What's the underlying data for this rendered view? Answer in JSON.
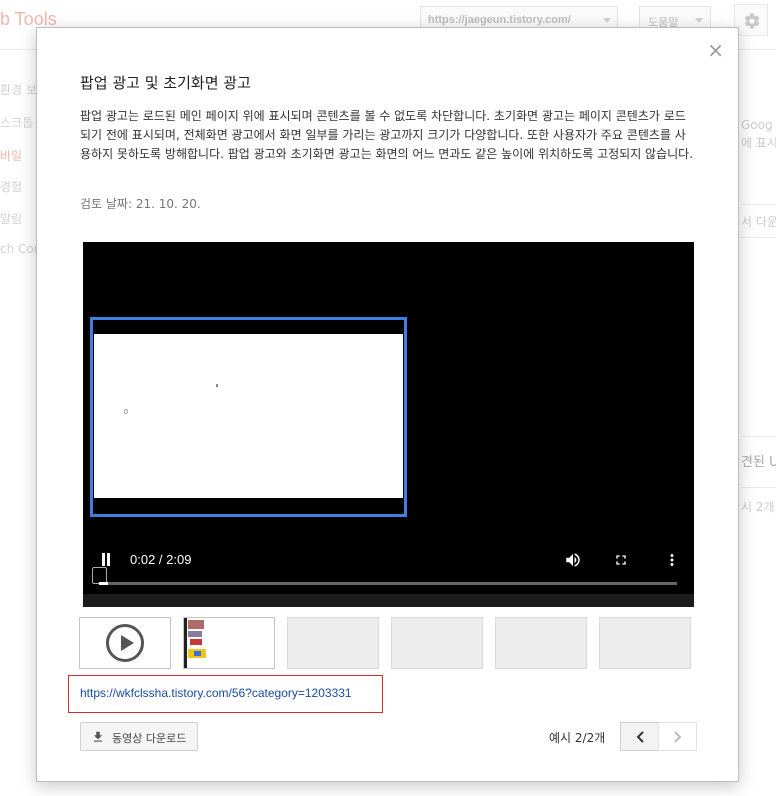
{
  "background": {
    "app_title": "b Tools",
    "url_select": "https://jaegeun.tistory.com/",
    "help_label": "도움말",
    "nav_items": [
      "환경 보",
      "스크톱",
      "바일",
      "경험",
      "알림",
      "ch Con"
    ],
    "active_nav_index": 2,
    "right_texts": [
      "Goog",
      "에 표시",
      "서 다운",
      "견된 U",
      "시 2개"
    ]
  },
  "modal": {
    "close_label": "×",
    "title": "팝업 광고 및 초기화면 광고",
    "description": "팝업 광고는 로드된 메인 페이지 위에 표시되며 콘텐츠를 볼 수 없도록 차단합니다. 초기화면 광고는 페이지 콘텐츠가 로드되기 전에 표시되며, 전체화면 광고에서 화면 일부를 가리는 광고까지 크기가 다양합니다. 또한 사용자가 주요 콘텐츠를 사용하지 못하도록 방해합니다. 팝업 광고와 초기화면 광고는 화면의 어느 면과도 같은 높이에 위치하도록 고정되지 않습니다.",
    "review_date": "검토 날짜: 21. 10. 20.",
    "video": {
      "current_time": "0:02",
      "duration": "2:09",
      "time_display": "0:02 / 2:09",
      "progress_fraction": 0.016,
      "is_playing": true
    },
    "thumbnails": [
      {
        "kind": "play-icon"
      },
      {
        "kind": "screenshot"
      },
      {
        "kind": "empty"
      },
      {
        "kind": "empty"
      },
      {
        "kind": "empty"
      },
      {
        "kind": "empty"
      }
    ],
    "link_url": "https://wkfclssha.tistory.com/56?category=1203331",
    "download_label": "동영상 다운로드",
    "pager_text": "예시 2/2개",
    "colors": {
      "highlight_frame": "#3f7fe0",
      "link": "#1a4aa8",
      "link_box_border": "#d32f2f"
    }
  }
}
